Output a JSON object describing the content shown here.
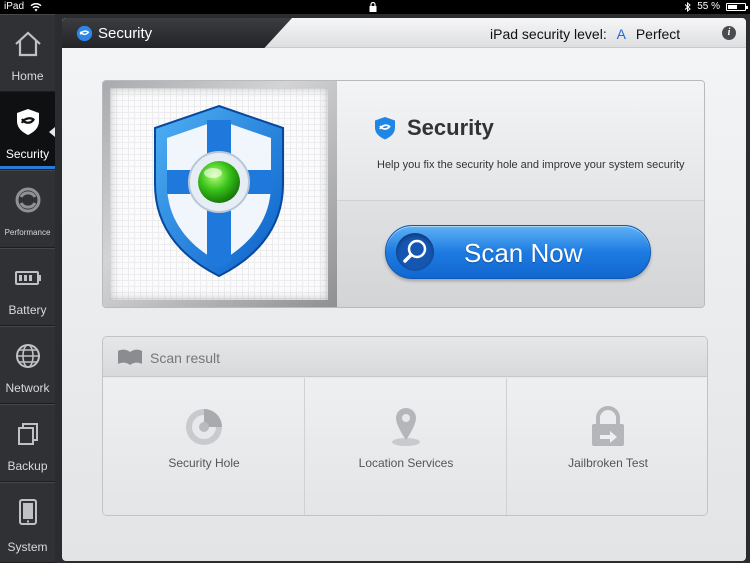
{
  "status_bar": {
    "device": "iPad",
    "battery": "55 %"
  },
  "sidebar": {
    "items": [
      {
        "label": "Home",
        "icon": "home-icon"
      },
      {
        "label": "Security",
        "icon": "shield-icon",
        "active": true
      },
      {
        "label": "Performance",
        "icon": "performance-icon"
      },
      {
        "label": "Battery",
        "icon": "battery-icon"
      },
      {
        "label": "Network",
        "icon": "globe-icon"
      },
      {
        "label": "Backup",
        "icon": "copy-icon"
      },
      {
        "label": "System",
        "icon": "device-icon"
      }
    ]
  },
  "header": {
    "tab_title": "Security",
    "level_label": "iPad security level:",
    "level_grade": "A",
    "level_status": "Perfect",
    "info": "i"
  },
  "hero": {
    "title": "Security",
    "description": "Help you fix the security hole and improve your system security",
    "scan_label": "Scan Now"
  },
  "result": {
    "title": "Scan result",
    "cells": [
      {
        "label": "Security Hole",
        "icon": "radar-icon"
      },
      {
        "label": "Location Services",
        "icon": "location-pin-icon"
      },
      {
        "label": "Jailbroken Test",
        "icon": "lock-icon"
      }
    ]
  },
  "colors": {
    "accent": "#1f7be2",
    "sidebar": "#2f3134",
    "panel": "#ebeced"
  }
}
